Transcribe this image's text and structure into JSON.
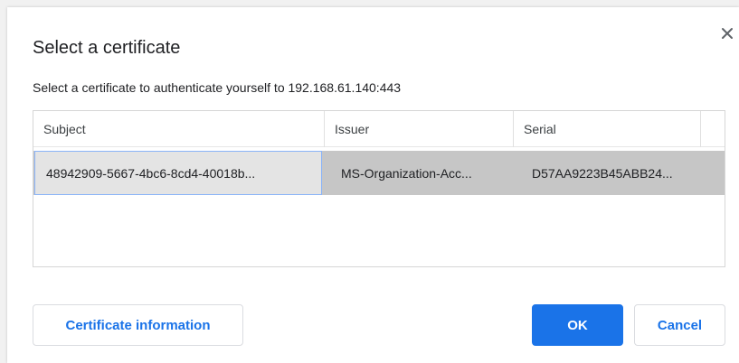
{
  "dialog": {
    "title": "Select a certificate",
    "subtitle": "Select a certificate to authenticate yourself to 192.168.61.140:443",
    "close_icon": "close-icon"
  },
  "table": {
    "columns": [
      "Subject",
      "Issuer",
      "Serial"
    ],
    "rows": [
      {
        "subject": "48942909-5667-4bc6-8cd4-40018b...",
        "issuer": "MS-Organization-Acc...",
        "serial": "D57AA9223B45ABB24...",
        "selected": true
      }
    ]
  },
  "buttons": {
    "info_label": "Certificate information",
    "ok_label": "OK",
    "cancel_label": "Cancel"
  },
  "colors": {
    "accent": "#1a73e8",
    "selected_row": "#c6c6c6",
    "focus_outline": "#8ab4f8"
  }
}
